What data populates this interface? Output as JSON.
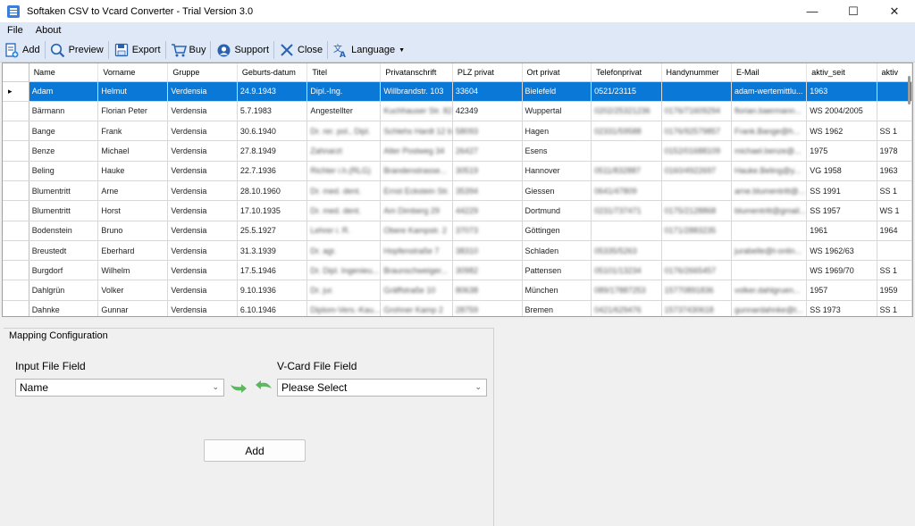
{
  "window": {
    "title": "Softaken CSV to Vcard Converter - Trial Version 3.0"
  },
  "menu": [
    "File",
    "About"
  ],
  "toolbar": {
    "add": "Add",
    "preview": "Preview",
    "export": "Export",
    "buy": "Buy",
    "support": "Support",
    "close": "Close",
    "language": "Language"
  },
  "grid": {
    "columns": [
      "Name",
      "Vorname",
      "Gruppe",
      "Geburts-datum",
      "Titel",
      "Privatanschrift",
      "PLZ privat",
      "Ort privat",
      "Telefonprivat",
      "Handynummer",
      "E-Mail",
      "aktiv_seit",
      "aktiv"
    ],
    "rows": [
      [
        "Adam",
        "Helmut",
        "Verdensia",
        "24.9.1943",
        "Dipl.-Ing.",
        "Willbrandstr. 103",
        "33604",
        "Bielefeld",
        "0521/23115",
        "",
        "adam-wertemittlu...",
        "1963",
        ""
      ],
      [
        "Bärmann",
        "Florian Peter",
        "Verdensia",
        "5.7.1983",
        "Angestellter",
        "Kuchhauser Str. 82",
        "42349",
        "Wuppertal",
        "0202/25321236",
        "0176/71609294",
        "florian.baermann...",
        "WS 2004/2005",
        ""
      ],
      [
        "Bange",
        "Frank",
        "Verdensia",
        "30.6.1940",
        "Dr. rer. pol., Dipl.",
        "Schlehs Hardt 12 b",
        "58093",
        "Hagen",
        "02331/59588",
        "0176/92579857",
        "Frank.Bange@h...",
        "WS 1962",
        "SS 1"
      ],
      [
        "Benze",
        "Michael",
        "Verdensia",
        "27.8.1949",
        "Zahnarzt",
        "Alter Postweg 34",
        "26427",
        "Esens",
        "",
        "0152/01688109",
        "michael.benze@...",
        "1975",
        "1978"
      ],
      [
        "Beling",
        "Hauke",
        "Verdensia",
        "22.7.1936",
        "Richter i.h.(RLG)",
        "Brandenstrasse...",
        "30519",
        "Hannover",
        "0511/832887",
        "0160/4922697",
        "Hauke.Beling@y...",
        "VG 1958",
        "1963"
      ],
      [
        "Blumentritt",
        "Arne",
        "Verdensia",
        "28.10.1960",
        "Dr. med. dent.",
        "Ernst Eckstein Str.",
        "35394",
        "Giessen",
        "0641/47809",
        "",
        "arne.blumentritt@...",
        "SS 1991",
        "SS 1"
      ],
      [
        "Blumentritt",
        "Horst",
        "Verdensia",
        "17.10.1935",
        "Dr. med. dent.",
        "Am Dimberg 29",
        "44229",
        "Dortmund",
        "0231/737471",
        "0175/2128868",
        "blumentritt@gmail...",
        "SS 1957",
        "WS 1"
      ],
      [
        "Bodenstein",
        "Bruno",
        "Verdensia",
        "25.5.1927",
        "Lehrer i. R.",
        "Obere Kampstr. 2",
        "37073",
        "Göttingen",
        "",
        "0171/2883235",
        "",
        "1961",
        "1964"
      ],
      [
        "Breustedt",
        "Eberhard",
        "Verdensia",
        "31.3.1939",
        "Dr. agr.",
        "Hopfenstraße 7",
        "38310",
        "Schladen",
        "05335/5263",
        "",
        "jurabelle@t-onlin...",
        "WS 1962/63",
        ""
      ],
      [
        "Burgdorf",
        "Wilhelm",
        "Verdensia",
        "17.5.1946",
        "Dr. Dipl. Ingenieu...",
        "Braunschweiger...",
        "30982",
        "Pattensen",
        "05101/13234",
        "0176/2665457",
        "",
        "WS 1969/70",
        "SS 1"
      ],
      [
        "Dahlgrün",
        "Volker",
        "Verdensia",
        "9.10.1936",
        "Dr. jur.",
        "Gräffstraße 10",
        "80638",
        "München",
        "089/17887253",
        "15770891836",
        "volker.dahlgruen...",
        "1957",
        "1959"
      ],
      [
        "Dahnke",
        "Gunnar",
        "Verdensia",
        "6.10.1946",
        "Diplom-Vers.-Kau...",
        "Grohner Kamp 2",
        "28759",
        "Bremen",
        "0421/629476",
        "15737430618",
        "gunnardahnke@t...",
        "SS 1973",
        "SS 1"
      ]
    ]
  },
  "mapping": {
    "legend": "Mapping Configuration",
    "input_label": "Input File Field",
    "input_value": "Name",
    "vcard_label": "V-Card File Field",
    "vcard_value": "Please Select",
    "add_button": "Add"
  }
}
